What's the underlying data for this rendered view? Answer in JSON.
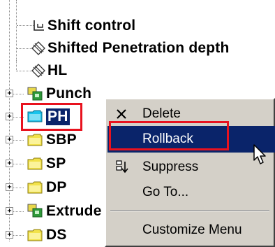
{
  "tree": {
    "items": [
      {
        "label": "Shift control",
        "icon": "shift-control-icon"
      },
      {
        "label": "Shifted Penetration depth",
        "icon": "penetration-depth-icon"
      },
      {
        "label": "HL",
        "icon": "penetration-depth-icon"
      },
      {
        "label": "Punch",
        "icon": "feature-icon"
      },
      {
        "label": "PH",
        "icon": "folder-icon"
      },
      {
        "label": "SBP",
        "icon": "folder-icon"
      },
      {
        "label": "SP",
        "icon": "folder-icon"
      },
      {
        "label": "DP",
        "icon": "folder-icon"
      },
      {
        "label": "Extrude",
        "icon": "feature-icon"
      },
      {
        "label": "DS",
        "icon": "folder-icon"
      }
    ],
    "expander_symbol": "+"
  },
  "context_menu": {
    "items": [
      {
        "label": "Delete",
        "icon": "delete-x-icon"
      },
      {
        "label": "Rollback",
        "highlighted": true
      },
      {
        "label": "Suppress",
        "icon": "suppress-icon"
      },
      {
        "label": "Go To..."
      },
      {
        "label": "Customize Menu"
      }
    ]
  },
  "colors": {
    "selection": "#0a246a",
    "menu_background": "#d4d0c8",
    "annotation_box": "#e8121e",
    "folder_yellow": "#f2e24a",
    "folder_cyan": "#19c4ec",
    "feature_green": "#2e9a3a"
  }
}
